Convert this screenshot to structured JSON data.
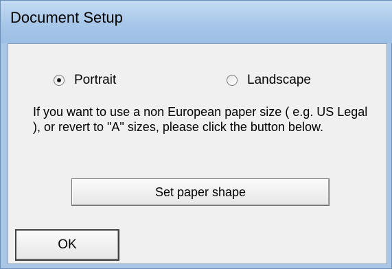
{
  "window": {
    "title": "Document Setup"
  },
  "orientation": {
    "portrait_label": "Portrait",
    "landscape_label": "Landscape",
    "selected": "Portrait"
  },
  "info_text": "If you want to use a non European paper size ( e.g. US Legal ), or revert to \"A\" sizes, please click the button below.",
  "buttons": {
    "set_paper_shape": "Set paper shape",
    "ok": "OK"
  }
}
